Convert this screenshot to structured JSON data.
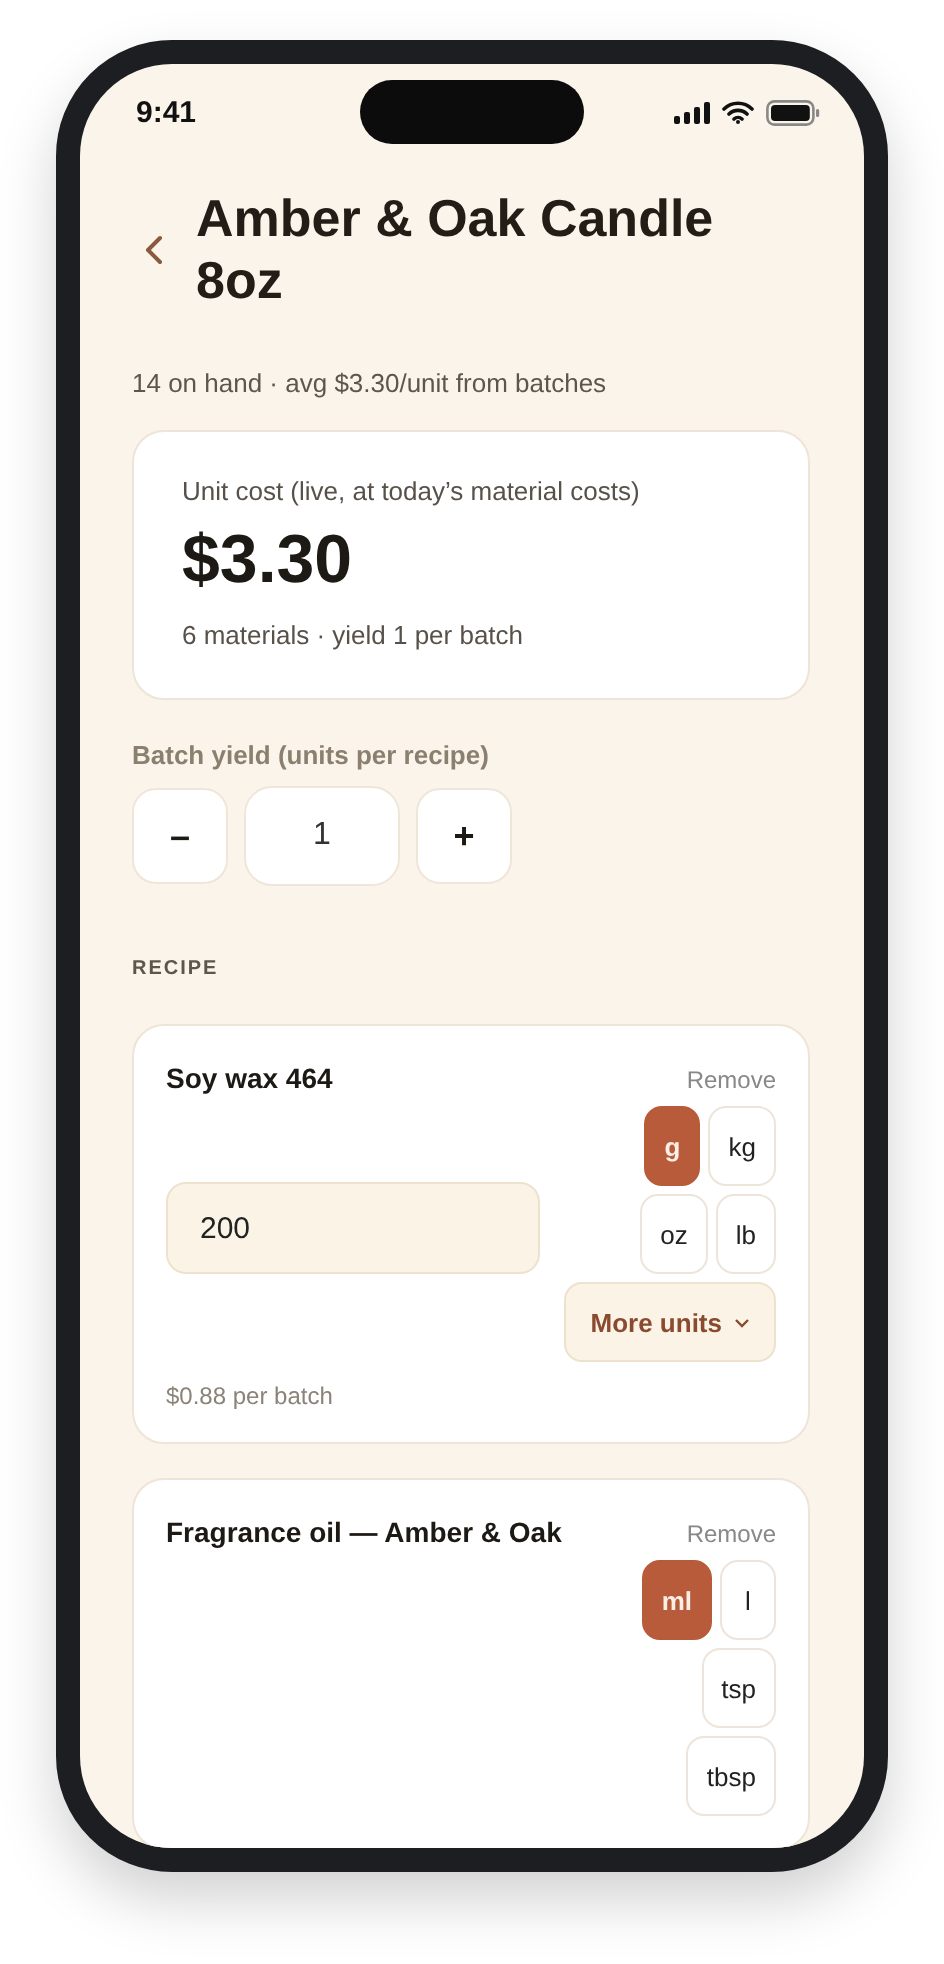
{
  "status_bar": {
    "time": "9:41"
  },
  "header": {
    "title": "Amber & Oak Candle 8oz",
    "subtitle": "14 on hand · avg $3.30/unit from batches"
  },
  "cost_card": {
    "label": "Unit cost (live, at today’s material costs)",
    "value": "$3.30",
    "detail": "6 materials · yield 1 per batch"
  },
  "batch_yield": {
    "label": "Batch yield (units per recipe)",
    "decrement": "–",
    "value": "1",
    "increment": "+"
  },
  "recipe": {
    "heading": "RECIPE",
    "items": [
      {
        "name": "Soy wax 464",
        "remove": "Remove",
        "amount": "200",
        "units": [
          {
            "label": "g",
            "selected": true
          },
          {
            "label": "kg",
            "selected": false
          },
          {
            "label": "oz",
            "selected": false
          },
          {
            "label": "lb",
            "selected": false
          }
        ],
        "more_units": "More units",
        "cost": "$0.88 per batch"
      },
      {
        "name": "Fragrance oil — Amber & Oak",
        "remove": "Remove",
        "units": [
          {
            "label": "ml",
            "selected": true
          },
          {
            "label": "l",
            "selected": false
          },
          {
            "label": "tsp",
            "selected": false
          },
          {
            "label": "tbsp",
            "selected": false
          }
        ]
      }
    ]
  }
}
